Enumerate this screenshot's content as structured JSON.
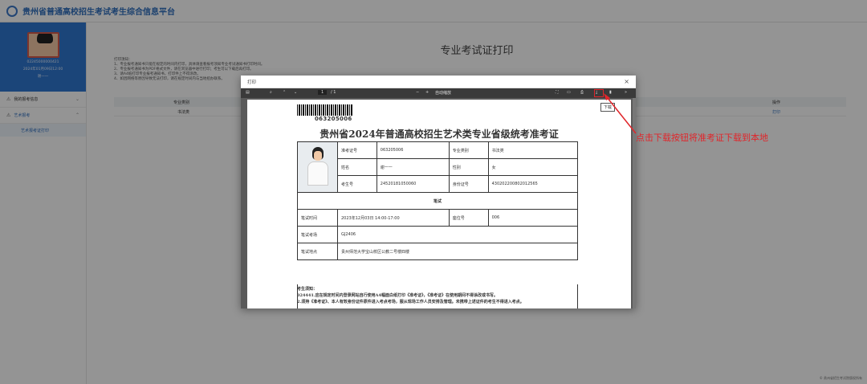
{
  "app": {
    "title": "贵州省普通高校招生考试考生综合信息平台"
  },
  "profile": {
    "id": "02245000000421",
    "date": "2024年01月09日12:00",
    "name": "谢一一"
  },
  "sidebar": {
    "items": [
      {
        "label": "我的报考信息"
      },
      {
        "label": "艺术报考"
      }
    ],
    "sub_item": "艺术报考证打印"
  },
  "main": {
    "title": "专业考试证打印",
    "notes": [
      "打印须知：",
      "1、专业报考通知书只能在规定的时间内打印，具体请查看报考须知专业考试通知书打印时间。",
      "2、专业报考通知书为PDF格式文件，请在浏览器中进行打印；考生可以下载后再打印。",
      "3、请A4纸打印专业报考通知书，打印件上不得涂改。",
      "4、如因网络等原因导致无法打印，请在规定时间内与当地招办联系。"
    ],
    "table": {
      "headers": [
        "专业类别",
        "操作"
      ],
      "row": [
        "书法类",
        "打印"
      ]
    }
  },
  "footer": "© 贵州省招生考试院版权所有",
  "dialog": {
    "title": "打印",
    "close": "×"
  },
  "pdf_toolbar": {
    "page": "1",
    "total": "/ 1",
    "zoom": "自动缩放"
  },
  "download_tip": "下载",
  "admit": {
    "barcode": "063205006",
    "title": "贵州省2024年普通高校招生艺术类专业省级统考准考证",
    "rows": [
      {
        "k1": "准考证号",
        "v1": "063205006",
        "k2": "专业类别",
        "v2": "书法类"
      },
      {
        "k1": "姓名",
        "v1": "谢一一",
        "k2": "性别",
        "v2": "女"
      },
      {
        "k1": "考生号",
        "v1": "24520181050060",
        "k2": "身份证号",
        "v2": "430202200802012565"
      }
    ],
    "section": "笔试",
    "exam": [
      {
        "k1": "笔试时间",
        "v1": "2023年12月03日 14:00-17:00",
        "k2": "座位号",
        "v2": "006"
      },
      {
        "k1": "笔试考场",
        "v1": "GJ2406"
      },
      {
        "k1": "笔试地点",
        "v1": "贵州师范大学宝山校区公教二号楼四楼"
      }
    ],
    "notice": [
      "考生须知：",
      "024441.应在规定时间内登录网站自行使用A4幅面白纸打印《准考证》，《准考证》在使用期间不得涂改或书写。",
      "2.须持《准考证》、本人有效身份证件原件进入考点考场，服从现场工作人员安排及管理。未携带上述证件的考生不得进入考点。"
    ]
  },
  "annotation": "点击下载按钮将准考证下载到本地",
  "colors": {
    "accent": "#2f78d0",
    "annotation": "#e0262b"
  }
}
